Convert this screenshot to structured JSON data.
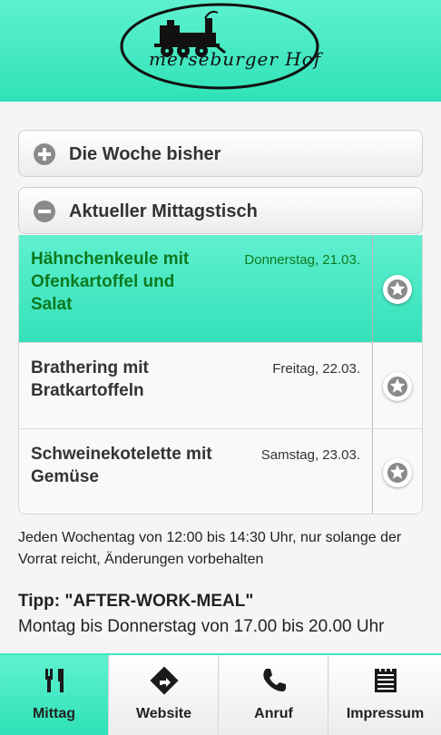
{
  "header": {
    "logo_text": "merseburger Hof"
  },
  "sections": [
    {
      "label": "Die Woche bisher",
      "icon": "plus-circle-icon",
      "expanded": false
    },
    {
      "label": "Aktueller Mittagstisch",
      "icon": "minus-circle-icon",
      "expanded": true
    }
  ],
  "menu": [
    {
      "name": "Hähnchenkeule mit Ofenkartoffel und Salat",
      "date": "Donnerstag, 21.03.",
      "highlighted": true
    },
    {
      "name": "Brathering mit Bratkartoffeln",
      "date": "Freitag, 22.03.",
      "highlighted": false
    },
    {
      "name": "Schweinekotelette mit Gemüse",
      "date": "Samstag, 23.03.",
      "highlighted": false
    }
  ],
  "note": "Jeden Wochentag von 12:00 bis 14:30 Uhr, nur solange der Vorrat reicht, Änderungen vorbehalten",
  "tipp": {
    "title": "Tipp: \"AFTER-WORK-MEAL\"",
    "text": "Montag bis Donnerstag von 17.00 bis 20.00 Uhr"
  },
  "nav": {
    "tabs": [
      {
        "label": "Mittag",
        "icon": "cutlery-icon",
        "active": true
      },
      {
        "label": "Website",
        "icon": "direction-sign-icon",
        "active": false
      },
      {
        "label": "Anruf",
        "icon": "phone-icon",
        "active": false
      },
      {
        "label": "Impressum",
        "icon": "calendar-list-icon",
        "active": false
      }
    ]
  },
  "colors": {
    "accent": "#3ee6bf",
    "highlight_text": "#0d7a1f"
  }
}
